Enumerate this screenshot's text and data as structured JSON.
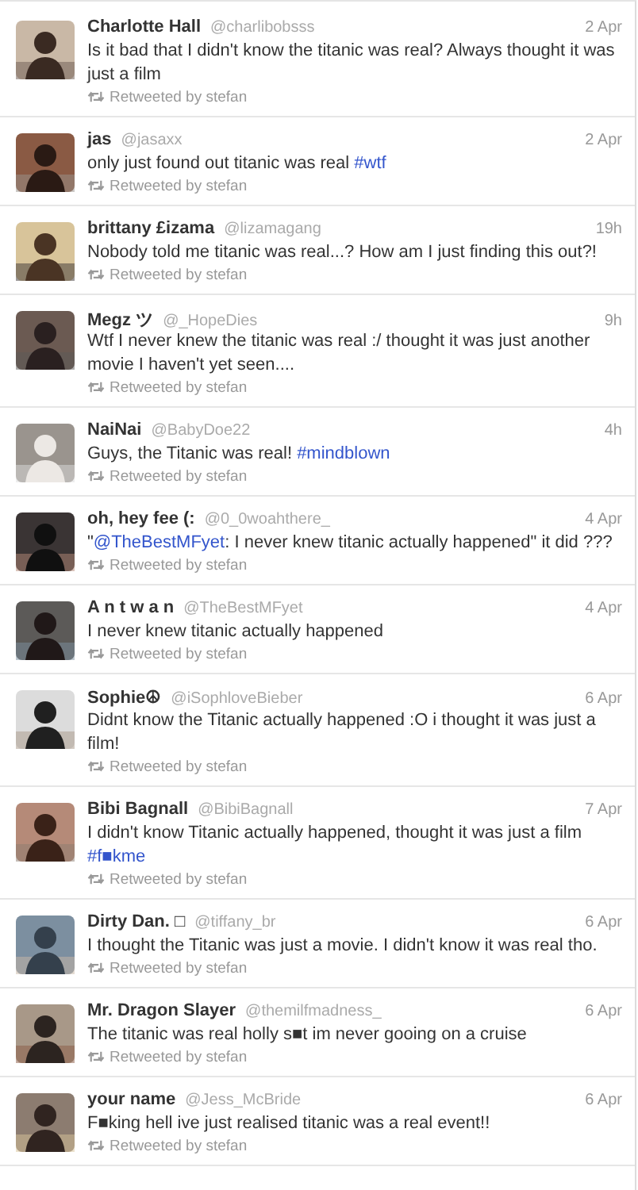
{
  "tweets": [
    {
      "name": "Charlotte Hall",
      "handle": "@charlibobsss",
      "time": "2 Apr",
      "text": [
        {
          "kind": "text",
          "text": "Is it bad that I didn't know the titanic was real? Always thought it was just a film"
        }
      ],
      "retweet": "Retweeted by stefan"
    },
    {
      "name": "jas",
      "handle": "@jasaxx",
      "time": "2 Apr",
      "text": [
        {
          "kind": "text",
          "text": "only just found out titanic was real "
        },
        {
          "kind": "hashtag",
          "text": "#wtf"
        }
      ],
      "retweet": "Retweeted by stefan"
    },
    {
      "name": "brittany £izama",
      "handle": "@lizamagang",
      "time": "19h",
      "text": [
        {
          "kind": "text",
          "text": "Nobody told me titanic was real...? How am I just finding this out?!"
        }
      ],
      "retweet": "Retweeted by stefan"
    },
    {
      "name": "Megz ツ",
      "handle": "@_HopeDies",
      "time": "9h",
      "text": [
        {
          "kind": "text",
          "text": "Wtf I never knew the titanic was real :/ thought it was just another movie I haven't yet seen...."
        }
      ],
      "retweet": "Retweeted by stefan"
    },
    {
      "name": "NaiNai",
      "handle": "@BabyDoe22",
      "time": "4h",
      "text": [
        {
          "kind": "text",
          "text": "Guys, the Titanic was real! "
        },
        {
          "kind": "hashtag",
          "text": "#mindblown"
        }
      ],
      "retweet": "Retweeted by stefan"
    },
    {
      "name": "oh, hey fee (:",
      "handle": "@0_0woahthere_",
      "time": "4 Apr",
      "text": [
        {
          "kind": "text",
          "text": "\""
        },
        {
          "kind": "mention",
          "text": "@TheBestMFyet"
        },
        {
          "kind": "text",
          "text": ": I never knew titanic actually happened\" it did ???"
        }
      ],
      "retweet": "Retweeted by stefan"
    },
    {
      "name": "A n t w a n",
      "handle": "@TheBestMFyet",
      "time": "4 Apr",
      "text": [
        {
          "kind": "text",
          "text": "I never knew titanic actually happened"
        }
      ],
      "retweet": "Retweeted by stefan"
    },
    {
      "name": "Sophie☮",
      "handle": "@iSophloveBieber",
      "time": "6 Apr",
      "text": [
        {
          "kind": "text",
          "text": "Didnt know the Titanic actually happened :O i thought it was just a film!"
        }
      ],
      "retweet": "Retweeted by stefan"
    },
    {
      "name": "Bibi Bagnall",
      "handle": "@BibiBagnall",
      "time": "7 Apr",
      "text": [
        {
          "kind": "text",
          "text": "I didn't know Titanic actually happened, thought it was just a film "
        },
        {
          "kind": "hashtag",
          "text": "#f■kme"
        }
      ],
      "retweet": "Retweeted by stefan"
    },
    {
      "name": "Dirty Dan. □",
      "handle": "@tiffany_br",
      "time": "6 Apr",
      "text": [
        {
          "kind": "text",
          "text": "I thought the Titanic was just a movie. I didn't know it was real tho."
        }
      ],
      "retweet": "Retweeted by stefan"
    },
    {
      "name": "Mr. Dragon Slayer",
      "handle": "@themilfmadness_",
      "time": "6 Apr",
      "text": [
        {
          "kind": "text",
          "text": "The titanic was real holly s■t im never gooing on a cruise"
        }
      ],
      "retweet": "Retweeted by stefan"
    },
    {
      "name": "your name",
      "handle": "@Jess_McBride",
      "time": "6 Apr",
      "text": [
        {
          "kind": "text",
          "text": "F■king hell ive just realised titanic was a real event!!"
        }
      ],
      "retweet": "Retweeted by stefan"
    }
  ]
}
